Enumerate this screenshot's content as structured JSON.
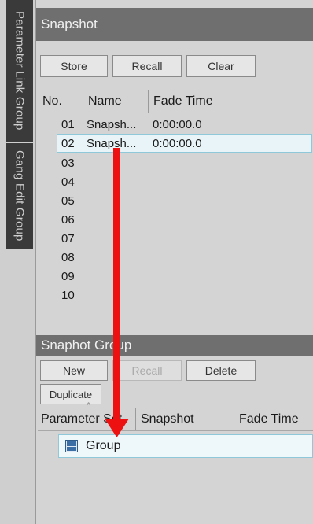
{
  "side_tabs": [
    "Parameter Link Group",
    "Gang Edit Group"
  ],
  "snapshot": {
    "title": "Snapshot",
    "buttons": {
      "store": "Store",
      "recall": "Recall",
      "clear": "Clear"
    },
    "columns": {
      "no": "No.",
      "name": "Name",
      "fade_time": "Fade Time"
    },
    "rows": [
      {
        "no": "01",
        "name": "Snapsh...",
        "fade": "0:00:00.0"
      },
      {
        "no": "02",
        "name": "Snapsh...",
        "fade": "0:00:00.0"
      },
      {
        "no": "03",
        "name": "",
        "fade": ""
      },
      {
        "no": "04",
        "name": "",
        "fade": ""
      },
      {
        "no": "05",
        "name": "",
        "fade": ""
      },
      {
        "no": "06",
        "name": "",
        "fade": ""
      },
      {
        "no": "07",
        "name": "",
        "fade": ""
      },
      {
        "no": "08",
        "name": "",
        "fade": ""
      },
      {
        "no": "09",
        "name": "",
        "fade": ""
      },
      {
        "no": "10",
        "name": "",
        "fade": ""
      }
    ]
  },
  "snapshot_group": {
    "title": "Snaphot Group",
    "buttons": {
      "new": "New",
      "recall": "Recall",
      "delete": "Delete",
      "duplicate": "Duplicate"
    },
    "columns": {
      "parameter_set": "Parameter Set",
      "snapshot": "Snapshot",
      "fade_time": "Fade Time"
    },
    "group_item": "Group"
  },
  "colors": {
    "arrow": "#ee1111",
    "selection_border": "#8fc9d9",
    "header_bg": "#6f6f6f"
  },
  "icons": {
    "group": "grid-group-icon",
    "sort": "sort-caret-up-icon",
    "drag": "drag-arrow-annotation"
  }
}
